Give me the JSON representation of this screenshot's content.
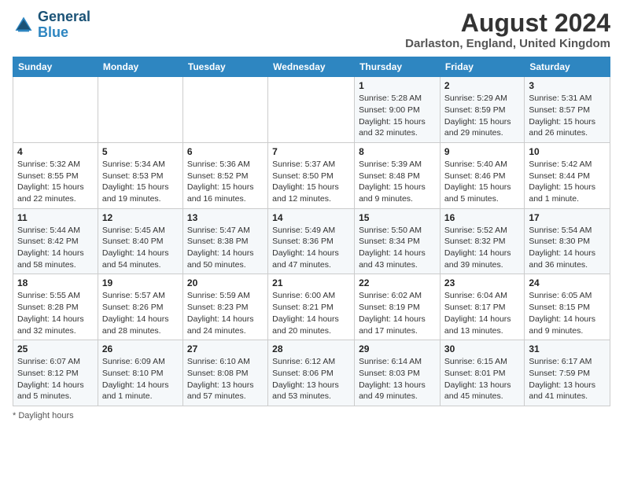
{
  "header": {
    "logo_line1": "General",
    "logo_line2": "Blue",
    "month_title": "August 2024",
    "location": "Darlaston, England, United Kingdom"
  },
  "weekdays": [
    "Sunday",
    "Monday",
    "Tuesday",
    "Wednesday",
    "Thursday",
    "Friday",
    "Saturday"
  ],
  "weeks": [
    [
      {
        "day": "",
        "info": ""
      },
      {
        "day": "",
        "info": ""
      },
      {
        "day": "",
        "info": ""
      },
      {
        "day": "",
        "info": ""
      },
      {
        "day": "1",
        "info": "Sunrise: 5:28 AM\nSunset: 9:00 PM\nDaylight: 15 hours\nand 32 minutes."
      },
      {
        "day": "2",
        "info": "Sunrise: 5:29 AM\nSunset: 8:59 PM\nDaylight: 15 hours\nand 29 minutes."
      },
      {
        "day": "3",
        "info": "Sunrise: 5:31 AM\nSunset: 8:57 PM\nDaylight: 15 hours\nand 26 minutes."
      }
    ],
    [
      {
        "day": "4",
        "info": "Sunrise: 5:32 AM\nSunset: 8:55 PM\nDaylight: 15 hours\nand 22 minutes."
      },
      {
        "day": "5",
        "info": "Sunrise: 5:34 AM\nSunset: 8:53 PM\nDaylight: 15 hours\nand 19 minutes."
      },
      {
        "day": "6",
        "info": "Sunrise: 5:36 AM\nSunset: 8:52 PM\nDaylight: 15 hours\nand 16 minutes."
      },
      {
        "day": "7",
        "info": "Sunrise: 5:37 AM\nSunset: 8:50 PM\nDaylight: 15 hours\nand 12 minutes."
      },
      {
        "day": "8",
        "info": "Sunrise: 5:39 AM\nSunset: 8:48 PM\nDaylight: 15 hours\nand 9 minutes."
      },
      {
        "day": "9",
        "info": "Sunrise: 5:40 AM\nSunset: 8:46 PM\nDaylight: 15 hours\nand 5 minutes."
      },
      {
        "day": "10",
        "info": "Sunrise: 5:42 AM\nSunset: 8:44 PM\nDaylight: 15 hours\nand 1 minute."
      }
    ],
    [
      {
        "day": "11",
        "info": "Sunrise: 5:44 AM\nSunset: 8:42 PM\nDaylight: 14 hours\nand 58 minutes."
      },
      {
        "day": "12",
        "info": "Sunrise: 5:45 AM\nSunset: 8:40 PM\nDaylight: 14 hours\nand 54 minutes."
      },
      {
        "day": "13",
        "info": "Sunrise: 5:47 AM\nSunset: 8:38 PM\nDaylight: 14 hours\nand 50 minutes."
      },
      {
        "day": "14",
        "info": "Sunrise: 5:49 AM\nSunset: 8:36 PM\nDaylight: 14 hours\nand 47 minutes."
      },
      {
        "day": "15",
        "info": "Sunrise: 5:50 AM\nSunset: 8:34 PM\nDaylight: 14 hours\nand 43 minutes."
      },
      {
        "day": "16",
        "info": "Sunrise: 5:52 AM\nSunset: 8:32 PM\nDaylight: 14 hours\nand 39 minutes."
      },
      {
        "day": "17",
        "info": "Sunrise: 5:54 AM\nSunset: 8:30 PM\nDaylight: 14 hours\nand 36 minutes."
      }
    ],
    [
      {
        "day": "18",
        "info": "Sunrise: 5:55 AM\nSunset: 8:28 PM\nDaylight: 14 hours\nand 32 minutes."
      },
      {
        "day": "19",
        "info": "Sunrise: 5:57 AM\nSunset: 8:26 PM\nDaylight: 14 hours\nand 28 minutes."
      },
      {
        "day": "20",
        "info": "Sunrise: 5:59 AM\nSunset: 8:23 PM\nDaylight: 14 hours\nand 24 minutes."
      },
      {
        "day": "21",
        "info": "Sunrise: 6:00 AM\nSunset: 8:21 PM\nDaylight: 14 hours\nand 20 minutes."
      },
      {
        "day": "22",
        "info": "Sunrise: 6:02 AM\nSunset: 8:19 PM\nDaylight: 14 hours\nand 17 minutes."
      },
      {
        "day": "23",
        "info": "Sunrise: 6:04 AM\nSunset: 8:17 PM\nDaylight: 14 hours\nand 13 minutes."
      },
      {
        "day": "24",
        "info": "Sunrise: 6:05 AM\nSunset: 8:15 PM\nDaylight: 14 hours\nand 9 minutes."
      }
    ],
    [
      {
        "day": "25",
        "info": "Sunrise: 6:07 AM\nSunset: 8:12 PM\nDaylight: 14 hours\nand 5 minutes."
      },
      {
        "day": "26",
        "info": "Sunrise: 6:09 AM\nSunset: 8:10 PM\nDaylight: 14 hours\nand 1 minute."
      },
      {
        "day": "27",
        "info": "Sunrise: 6:10 AM\nSunset: 8:08 PM\nDaylight: 13 hours\nand 57 minutes."
      },
      {
        "day": "28",
        "info": "Sunrise: 6:12 AM\nSunset: 8:06 PM\nDaylight: 13 hours\nand 53 minutes."
      },
      {
        "day": "29",
        "info": "Sunrise: 6:14 AM\nSunset: 8:03 PM\nDaylight: 13 hours\nand 49 minutes."
      },
      {
        "day": "30",
        "info": "Sunrise: 6:15 AM\nSunset: 8:01 PM\nDaylight: 13 hours\nand 45 minutes."
      },
      {
        "day": "31",
        "info": "Sunrise: 6:17 AM\nSunset: 7:59 PM\nDaylight: 13 hours\nand 41 minutes."
      }
    ]
  ],
  "footer": {
    "note": "Daylight hours"
  }
}
